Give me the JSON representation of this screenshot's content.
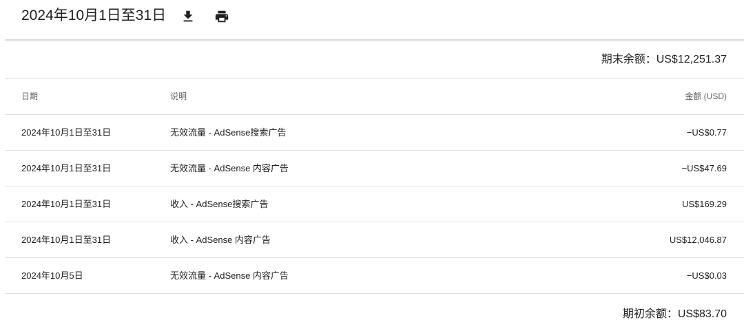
{
  "header": {
    "title": "2024年10月1日至31日",
    "download_icon": "download-icon",
    "print_icon": "print-icon"
  },
  "closing_balance": "期末余额：US$12,251.37",
  "table": {
    "columns": {
      "date": "日期",
      "description": "说明",
      "amount": "金额 (USD)"
    },
    "rows": [
      {
        "date": "2024年10月1日至31日",
        "description": "无效流量 - AdSense搜索广告",
        "amount": "−US$0.77"
      },
      {
        "date": "2024年10月1日至31日",
        "description": "无效流量 - AdSense 内容广告",
        "amount": "−US$47.69"
      },
      {
        "date": "2024年10月1日至31日",
        "description": "收入 - AdSense搜索广告",
        "amount": "US$169.29"
      },
      {
        "date": "2024年10月1日至31日",
        "description": "收入 - AdSense 内容广告",
        "amount": "US$12,046.87"
      },
      {
        "date": "2024年10月5日",
        "description": "无效流量 - AdSense 内容广告",
        "amount": "−US$0.03"
      }
    ]
  },
  "opening_balance": "期初余额：US$83.70"
}
